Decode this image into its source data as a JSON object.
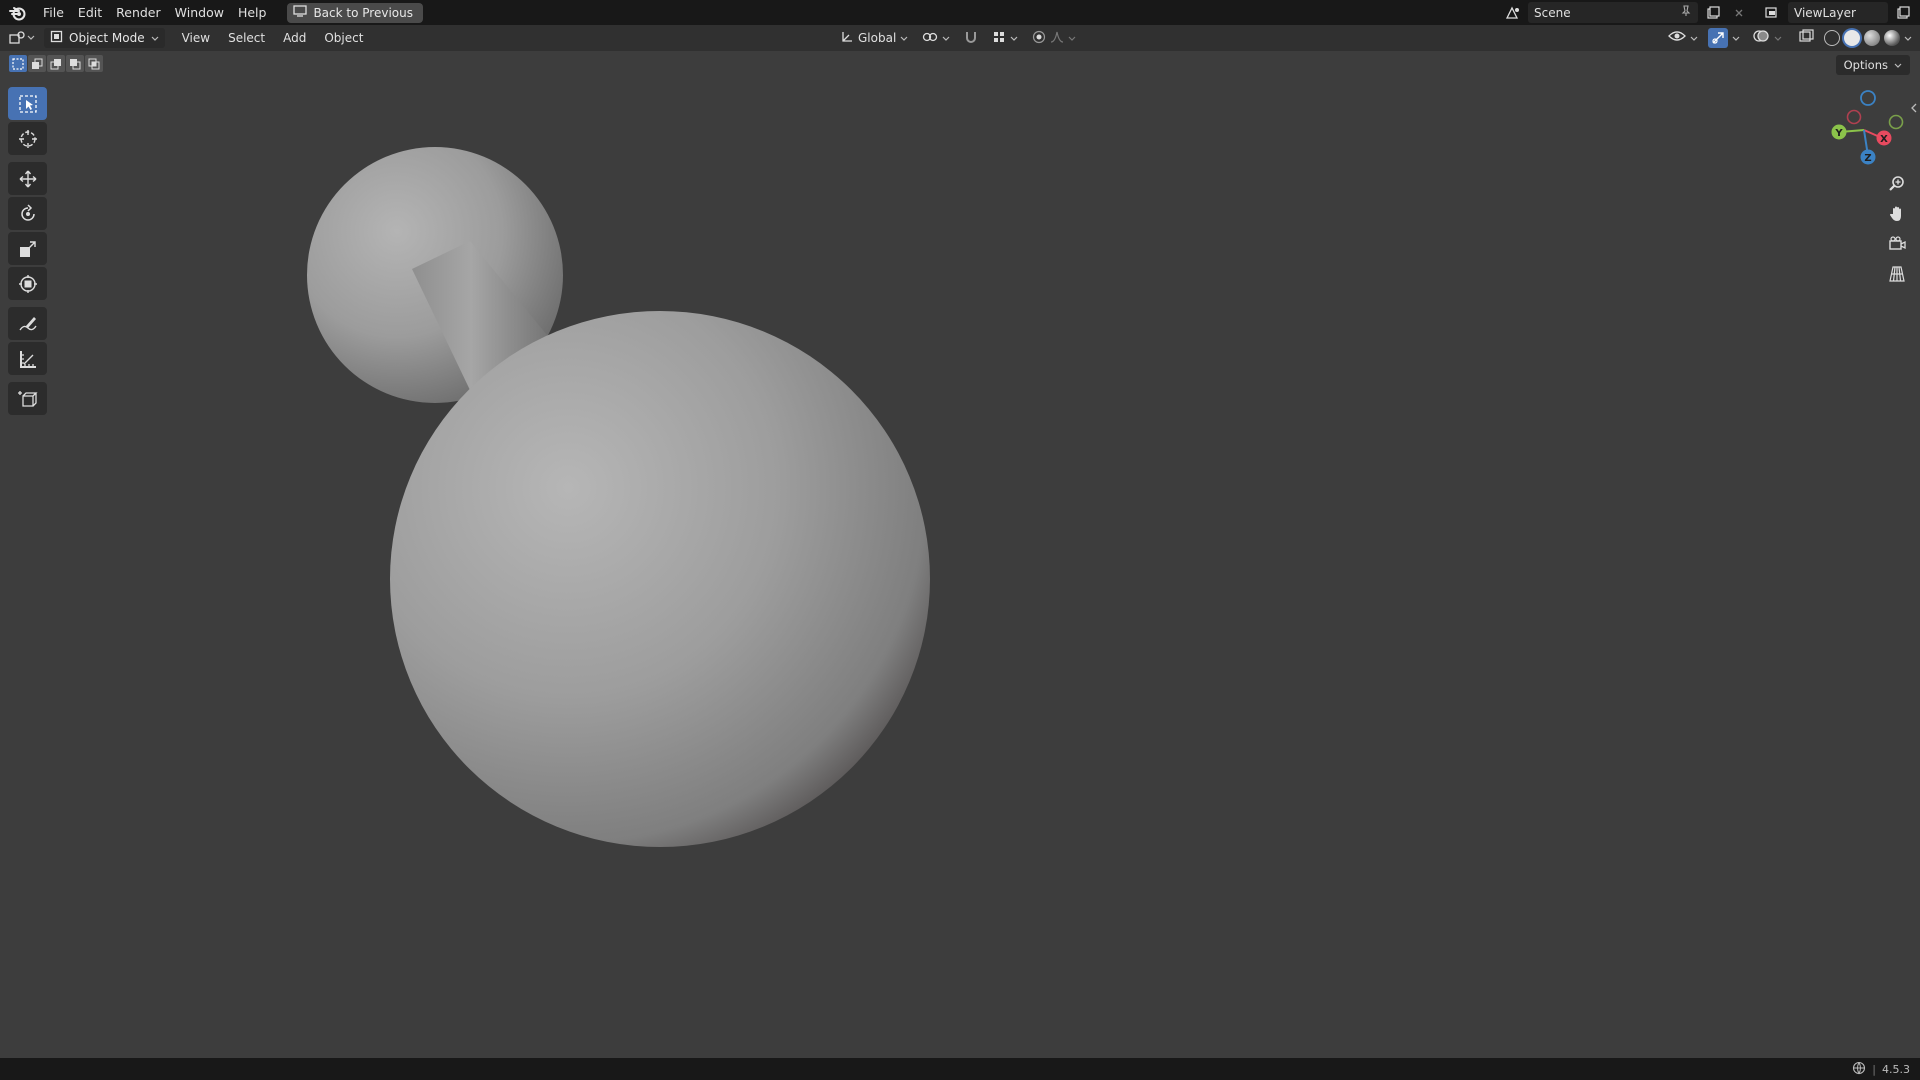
{
  "menubar": {
    "items": [
      "File",
      "Edit",
      "Render",
      "Window",
      "Help"
    ],
    "back_button": "Back to Previous",
    "scene": "Scene",
    "view_layer": "ViewLayer"
  },
  "viewport_header": {
    "mode": "Object Mode",
    "menus": [
      "View",
      "Select",
      "Add",
      "Object"
    ],
    "transform_orientation": "Global",
    "options_label": "Options"
  },
  "toolbar": {
    "tools": [
      "select-box",
      "cursor",
      "move",
      "rotate",
      "scale",
      "transform",
      "annotate",
      "measure",
      "add-cube"
    ],
    "active": "select-box"
  },
  "gizmo": {
    "axes": [
      "X",
      "Y",
      "Z"
    ],
    "colors": {
      "x": "#e84a5f",
      "y": "#8bc34a",
      "z": "#3b82c4"
    }
  },
  "statusbar": {
    "version": "4.5.3"
  },
  "colors": {
    "viewport_bg": "#3d3d3d",
    "accent": "#4772b3"
  }
}
